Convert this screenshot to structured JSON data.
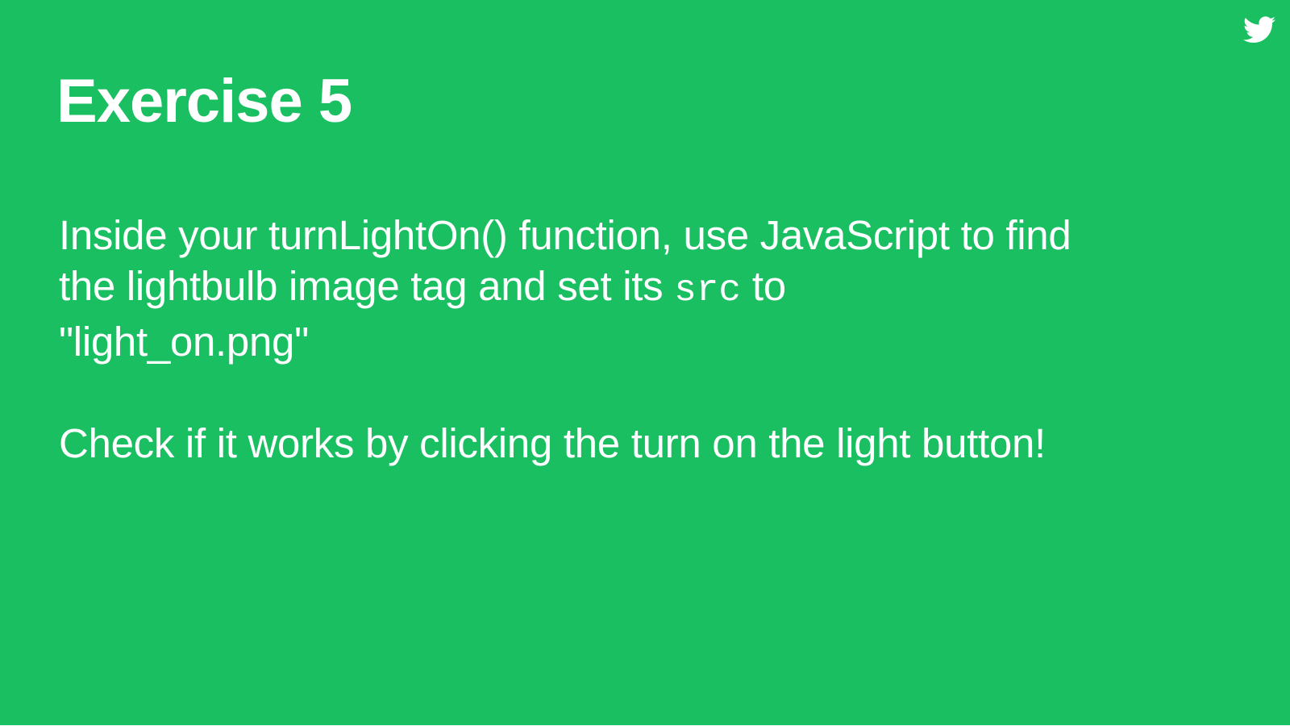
{
  "slide": {
    "title": "Exercise 5",
    "icon": "twitter-bird-icon",
    "background_color": "#1abf62",
    "text_color": "#ffffff",
    "paragraph1": {
      "line1": "Inside your turnLightOn() function, use JavaScript to find",
      "line2_before": "the lightbulb image tag and set its ",
      "line2_code": "src",
      "line2_after": " to",
      "line3": "\"light_on.png\""
    },
    "paragraph2": "Check if it works by clicking the turn on the light button!"
  }
}
